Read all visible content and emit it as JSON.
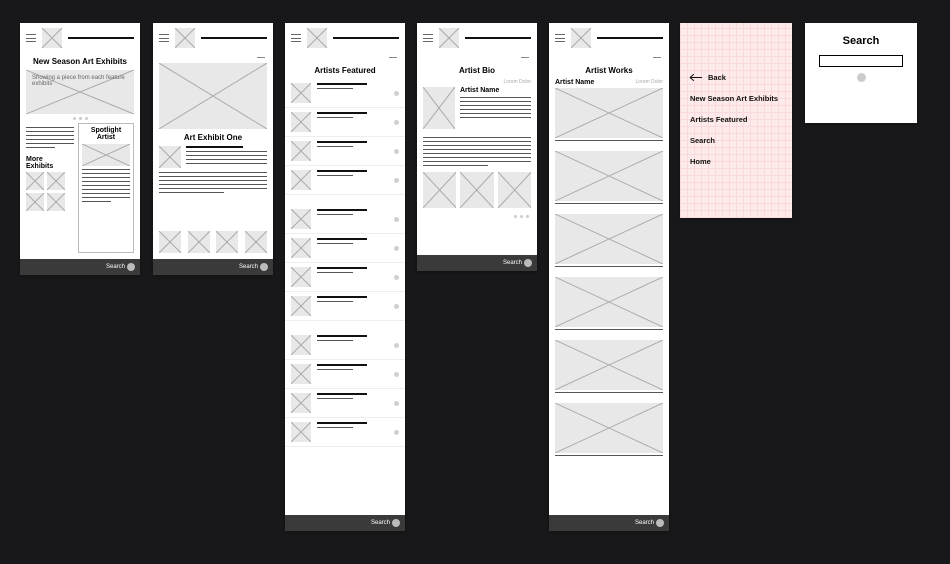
{
  "screens": {
    "home": {
      "title": "New Season Art Exhibits",
      "caption": "Showing a piece from each feature exhibits",
      "spotlight_heading": "Spotlight Artist",
      "more_heading": "More Exhibits",
      "footer": "Search"
    },
    "exhibit": {
      "title": "Art Exhibit One",
      "footer": "Search"
    },
    "artists": {
      "title": "Artists Featured",
      "footer": "Search"
    },
    "bio": {
      "title": "Artist Bio",
      "meta": "Lorem Dolor",
      "name": "Artist Name",
      "footer": "Search"
    },
    "works": {
      "title": "Artist Works",
      "meta": "Lorem Dolor",
      "name": "Artist Name",
      "footer": "Search"
    }
  },
  "menu": {
    "back": "Back",
    "items": [
      "New Season Art Exhibits",
      "Artists Featured",
      "Search",
      "Home"
    ]
  },
  "search_modal": {
    "title": "Search"
  }
}
